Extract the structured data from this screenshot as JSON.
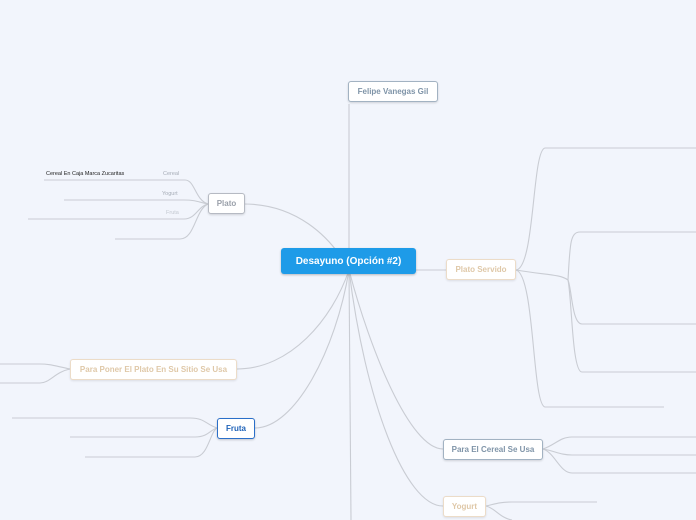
{
  "central": {
    "label": "Desayuno (Opción #2)"
  },
  "topics": [
    {
      "id": "author",
      "label": "Felipe Vanegas Gil"
    },
    {
      "id": "plato",
      "label": "Plato"
    },
    {
      "id": "plato_servido",
      "label": "Plato Servido"
    },
    {
      "id": "para_poner",
      "label": "Para Poner El Plato En Su Sitio Se Usa"
    },
    {
      "id": "fruta",
      "label": "Fruta"
    },
    {
      "id": "cereal",
      "label": "Para El Cereal Se Usa"
    },
    {
      "id": "yogurt",
      "label": "Yogurt"
    }
  ],
  "plato_leaves": [
    {
      "text": "Cereal En Caja Marca Zucaritas"
    },
    {
      "text": "Cereal"
    },
    {
      "text": "Yogurt"
    },
    {
      "text": "Fruta"
    }
  ],
  "colors": {
    "background": "#f2f5fc",
    "central": "#1e9be8",
    "selected_border": "#2a6fc9",
    "connector": "#c9ccd3"
  }
}
